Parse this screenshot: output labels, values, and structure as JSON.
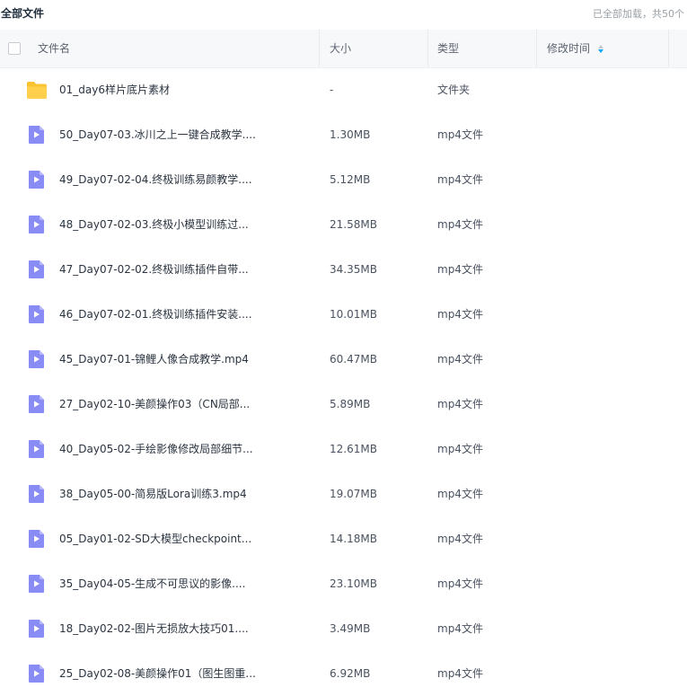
{
  "topbar": {
    "title": "全部文件",
    "status": "已全部加载，共50个"
  },
  "header": {
    "name": "文件名",
    "size": "大小",
    "type": "类型",
    "modified": "修改时间"
  },
  "colors": {
    "folder": "#fbc232",
    "video": "#8a8cf5",
    "sort_active": "#06a7ff"
  },
  "files": [
    {
      "name": "01_day6样片底片素材",
      "size": "-",
      "type": "文件夹",
      "icon": "folder-icon"
    },
    {
      "name": "50_Day07-03.冰川之上一键合成教学....",
      "size": "1.30MB",
      "type": "mp4文件",
      "icon": "video-file-icon"
    },
    {
      "name": "49_Day07-02-04.终极训练易颜教学....",
      "size": "5.12MB",
      "type": "mp4文件",
      "icon": "video-file-icon"
    },
    {
      "name": "48_Day07-02-03.终极小模型训练过...",
      "size": "21.58MB",
      "type": "mp4文件",
      "icon": "video-file-icon"
    },
    {
      "name": "47_Day07-02-02.终极训练插件自带...",
      "size": "34.35MB",
      "type": "mp4文件",
      "icon": "video-file-icon"
    },
    {
      "name": "46_Day07-02-01.终极训练插件安装....",
      "size": "10.01MB",
      "type": "mp4文件",
      "icon": "video-file-icon"
    },
    {
      "name": "45_Day07-01-锦鲤人像合成教学.mp4",
      "size": "60.47MB",
      "type": "mp4文件",
      "icon": "video-file-icon"
    },
    {
      "name": "27_Day02-10-美颜操作03（CN局部...",
      "size": "5.89MB",
      "type": "mp4文件",
      "icon": "video-file-icon"
    },
    {
      "name": "40_Day05-02-手绘影像修改局部细节...",
      "size": "12.61MB",
      "type": "mp4文件",
      "icon": "video-file-icon"
    },
    {
      "name": "38_Day05-00-简易版Lora训练3.mp4",
      "size": "19.07MB",
      "type": "mp4文件",
      "icon": "video-file-icon"
    },
    {
      "name": "05_Day01-02-SD大模型checkpoint...",
      "size": "14.18MB",
      "type": "mp4文件",
      "icon": "video-file-icon"
    },
    {
      "name": "35_Day04-05-生成不可思议的影像....",
      "size": "23.10MB",
      "type": "mp4文件",
      "icon": "video-file-icon"
    },
    {
      "name": "18_Day02-02-图片无损放大技巧01....",
      "size": "3.49MB",
      "type": "mp4文件",
      "icon": "video-file-icon"
    },
    {
      "name": "25_Day02-08-美颜操作01（图生图重...",
      "size": "6.92MB",
      "type": "mp4文件",
      "icon": "video-file-icon"
    }
  ]
}
